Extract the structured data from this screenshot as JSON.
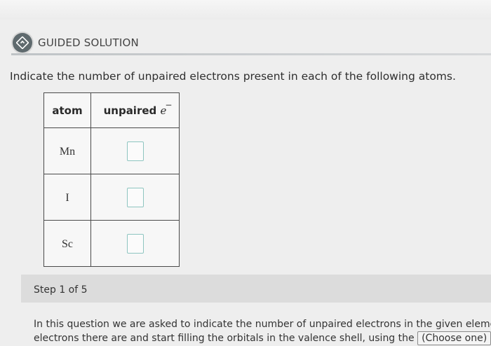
{
  "header": {
    "title": "GUIDED SOLUTION"
  },
  "question": {
    "instruction": "Indicate the number of unpaired electrons present in each of the following atoms."
  },
  "table": {
    "columns": [
      "atom",
      "unpaired"
    ],
    "electron_symbol": "e",
    "electron_superscript": "−",
    "rows": [
      {
        "atom": "Mn",
        "answer": ""
      },
      {
        "atom": "I",
        "answer": ""
      },
      {
        "atom": "Sc",
        "answer": ""
      }
    ]
  },
  "step": {
    "label": "Step 1 of 5",
    "line1": "In this question we are asked to indicate the number of unpaired electrons in the given eleme",
    "line2": "electrons there are and start filling the orbitals in the valence shell, using the",
    "dropdown_value": "(Choose one)"
  }
}
